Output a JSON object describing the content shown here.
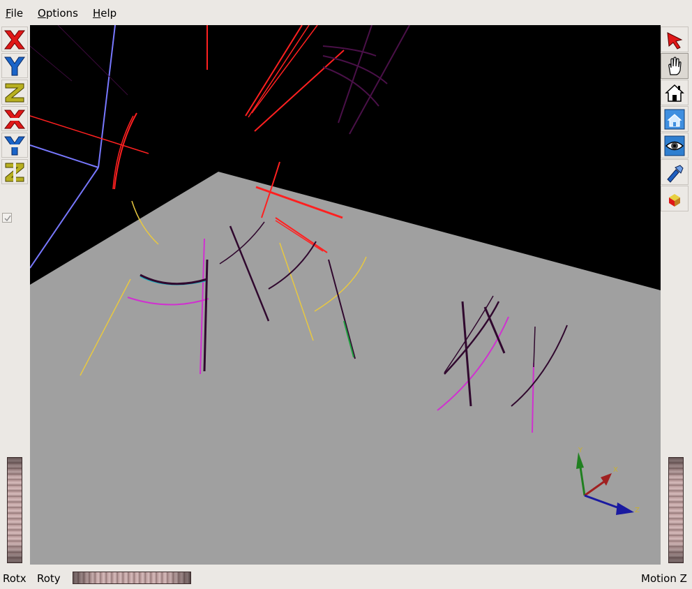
{
  "menu": {
    "file": {
      "mnemonic": "F",
      "rest": "ile"
    },
    "options": {
      "mnemonic": "O",
      "rest": "ptions"
    },
    "help": {
      "mnemonic": "H",
      "rest": "elp"
    }
  },
  "left_toolbar": {
    "buttons": [
      "x-axis-view",
      "y-axis-view",
      "z-axis-view",
      "negative-x-axis-view",
      "negative-y-axis-view",
      "negative-z-axis-view"
    ],
    "checkbox_checked": true
  },
  "right_toolbar": {
    "buttons": [
      "select-arrow",
      "pan-hand",
      "home",
      "set-home",
      "view-all",
      "seek-light",
      "draw-style"
    ],
    "pressed": "pan-hand"
  },
  "axes_triad": {
    "x_label": "X",
    "y_label": "Y",
    "z_label": "Z"
  },
  "bottom": {
    "rotx_label": "Rotx",
    "roty_label": "Roty",
    "motion_label": "Motion Z"
  },
  "colors": {
    "background": "#000000",
    "ground": "#a0a0a0",
    "frame_blue": "#7878ff",
    "track_red": "#ff2020",
    "track_magenta": "#d030d0",
    "track_yellow": "#e8d040",
    "track_dark_purple": "#401040",
    "axis_x": "#a02020",
    "axis_y": "#208020",
    "axis_z": "#1a1aa0"
  }
}
